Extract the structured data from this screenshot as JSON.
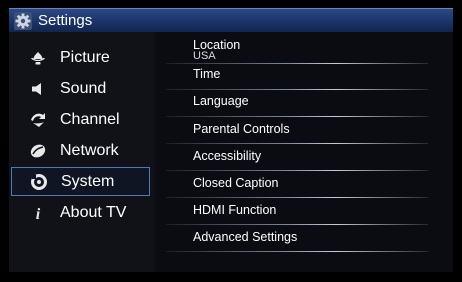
{
  "window": {
    "title": "Settings",
    "icon": "settings-gear-icon"
  },
  "sidebar": {
    "items": [
      {
        "label": "Picture",
        "icon": "picture-icon",
        "selected": false
      },
      {
        "label": "Sound",
        "icon": "sound-icon",
        "selected": false
      },
      {
        "label": "Channel",
        "icon": "channel-icon",
        "selected": false
      },
      {
        "label": "Network",
        "icon": "network-icon",
        "selected": false
      },
      {
        "label": "System",
        "icon": "system-icon",
        "selected": true
      },
      {
        "label": "About TV",
        "icon": "info-icon",
        "selected": false
      }
    ]
  },
  "menu": {
    "items": [
      {
        "label": "Location",
        "value": "USA"
      },
      {
        "label": "Time"
      },
      {
        "label": "Language"
      },
      {
        "label": "Parental Controls"
      },
      {
        "label": "Accessibility"
      },
      {
        "label": "Closed Caption"
      },
      {
        "label": "HDMI Function"
      },
      {
        "label": "Advanced Settings"
      }
    ]
  },
  "colors": {
    "title_bar": "#1a3366",
    "selection_border": "#4c7bb5",
    "background": "#000000"
  }
}
